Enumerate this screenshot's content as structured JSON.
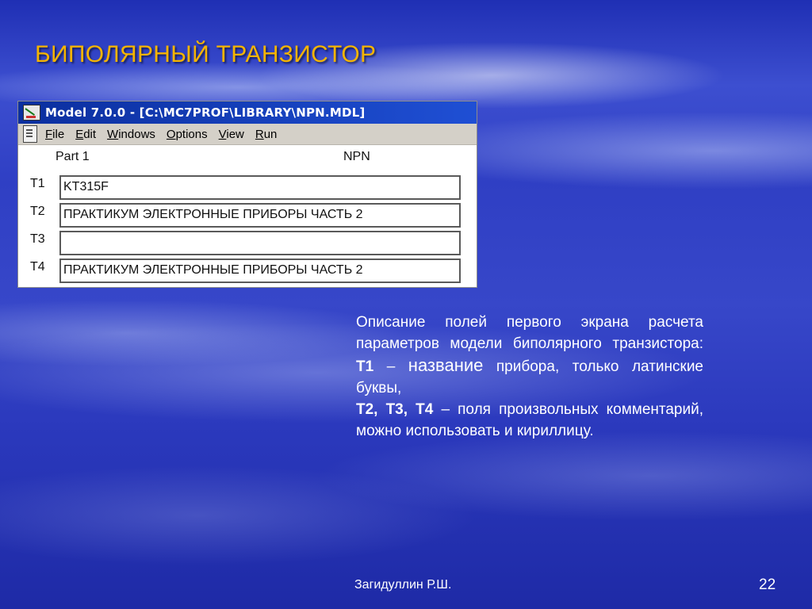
{
  "slide": {
    "title": "БИПОЛЯРНЫЙ ТРАНЗИСТОР",
    "author": "Загидуллин Р.Ш.",
    "page_number": "22"
  },
  "window": {
    "title": "Model 7.0.0 - [C:\\MC7PROF\\LIBRARY\\NPN.MDL]",
    "menu": [
      "File",
      "Edit",
      "Windows",
      "Options",
      "View",
      "Run"
    ],
    "part_label": "Part 1",
    "type_label": "NPN",
    "fields": [
      {
        "label": "T1",
        "value": "KT315F"
      },
      {
        "label": "T2",
        "value": "ПРАКТИКУМ ЭЛЕКТРОННЫЕ ПРИБОРЫ ЧАСТЬ 2"
      },
      {
        "label": "T3",
        "value": ""
      },
      {
        "label": "T4",
        "value": "ПРАКТИКУМ ЭЛЕКТРОННЫЕ ПРИБОРЫ ЧАСТЬ 2"
      }
    ]
  },
  "description": {
    "intro": "Описание полей первого экрана расчета параметров модели биполярного транзистора:",
    "t1_key": "Т1",
    "t1_dash": "–",
    "t1_word": "название",
    "t1_rest": "прибора, только латинские буквы,",
    "t234_key": "Т2, Т3, Т4",
    "t234_dash": "–",
    "t234_rest": "поля произвольных комментарий, можно использовать и кириллицу."
  },
  "colors": {
    "title": "#f5b400",
    "titlebar": "#0a36b0",
    "menubar": "#d4d0c8",
    "text": "#ffffff"
  },
  "icons": [
    "app-icon",
    "document-icon"
  ]
}
